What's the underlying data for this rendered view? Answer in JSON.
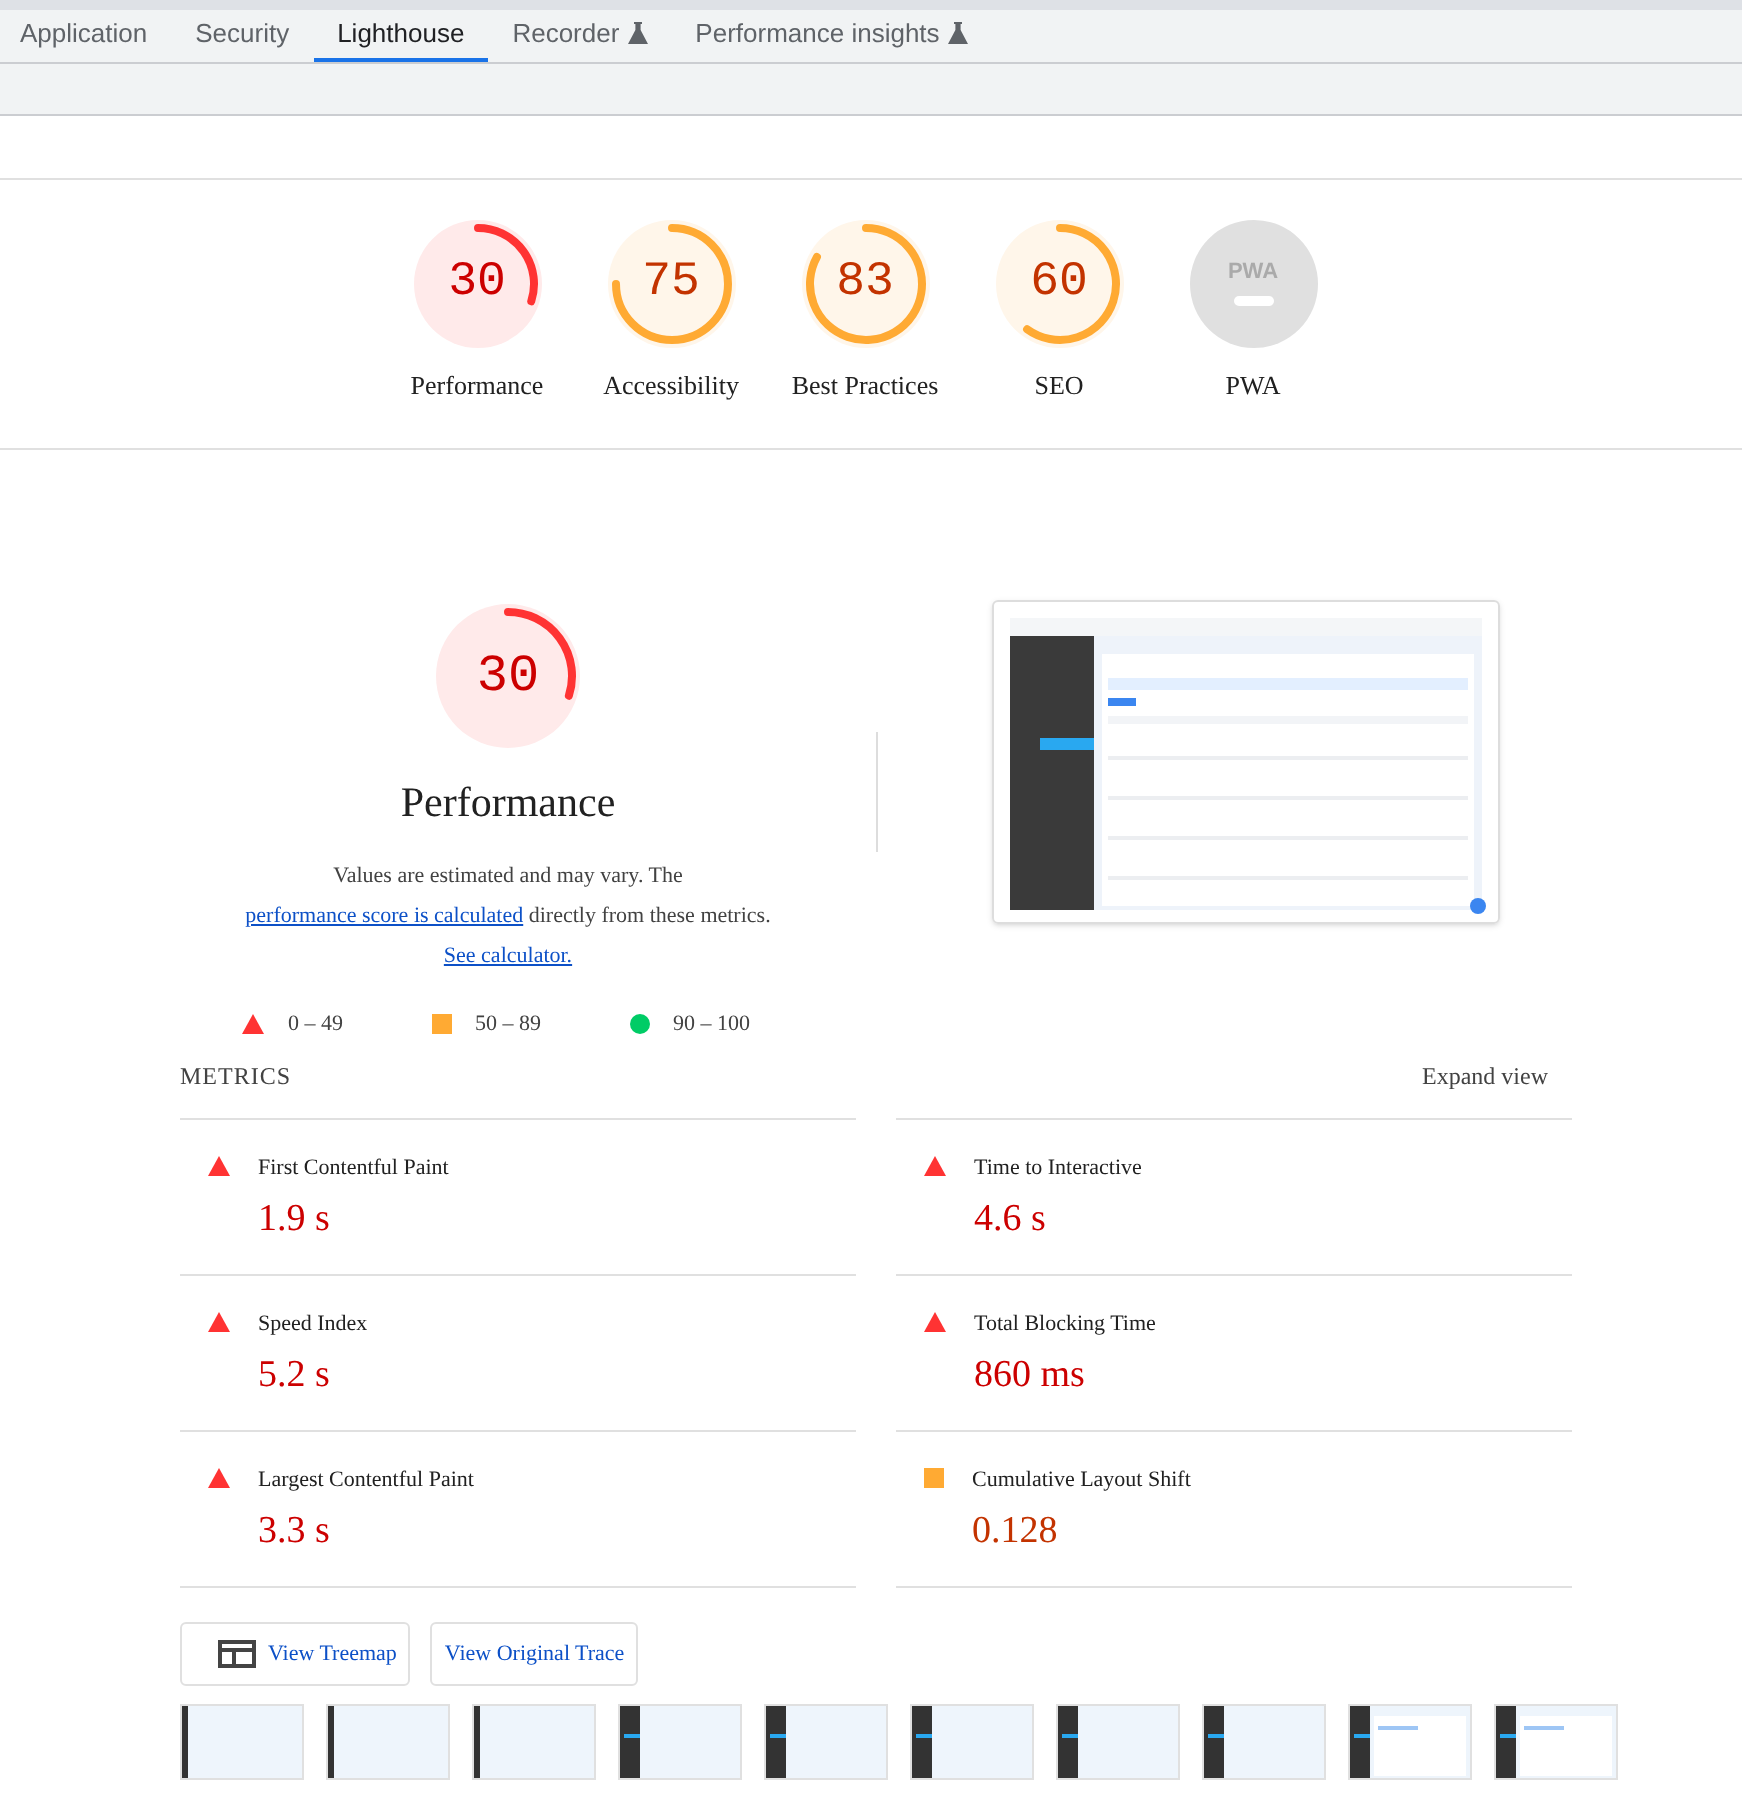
{
  "tabs": [
    {
      "label": "Application",
      "selected": false,
      "experiment": false
    },
    {
      "label": "Security",
      "selected": false,
      "experiment": false
    },
    {
      "label": "Lighthouse",
      "selected": true,
      "experiment": false
    },
    {
      "label": "Recorder",
      "selected": false,
      "experiment": true
    },
    {
      "label": "Performance insights",
      "selected": false,
      "experiment": true
    }
  ],
  "gauges": [
    {
      "kind": "fail",
      "score": "30",
      "label": "Performance"
    },
    {
      "kind": "average",
      "score": "75",
      "label": "Accessibility"
    },
    {
      "kind": "average",
      "score": "83",
      "label": "Best Practices"
    },
    {
      "kind": "average",
      "score": "60",
      "label": "SEO"
    },
    {
      "kind": "pwa",
      "badge": "PWA",
      "label": "PWA"
    }
  ],
  "performance": {
    "score": "30",
    "kind": "fail",
    "title": "Performance",
    "description": [
      {
        "kind": "text",
        "text": "Values are estimated and may vary. The "
      },
      {
        "kind": "link",
        "text": "performance score is calculated"
      },
      {
        "kind": "text",
        "text": " directly from these metrics. "
      },
      {
        "kind": "link",
        "text": "See calculator."
      }
    ],
    "legend": [
      {
        "kind": "fail",
        "range": "0 – 49"
      },
      {
        "kind": "average",
        "range": "50 – 89"
      },
      {
        "kind": "pass",
        "range": "90 – 100"
      }
    ]
  },
  "metrics": {
    "heading": "METRICS",
    "toggle": "Expand view",
    "items": [
      {
        "name": "First Contentful Paint",
        "value": "1.9 s",
        "kind": "fail"
      },
      {
        "name": "Time to Interactive",
        "value": "4.6 s",
        "kind": "fail"
      },
      {
        "name": "Speed Index",
        "value": "5.2 s",
        "kind": "fail"
      },
      {
        "name": "Total Blocking Time",
        "value": "860 ms",
        "kind": "fail"
      },
      {
        "name": "Largest Contentful Paint",
        "value": "3.3 s",
        "kind": "fail"
      },
      {
        "name": "Cumulative Layout Shift",
        "value": "0.128",
        "kind": "average"
      }
    ]
  },
  "buttons": [
    {
      "kind": "treemap",
      "label": "View Treemap"
    },
    {
      "kind": "trace",
      "label": "View Original Trace"
    }
  ],
  "filmstrip": [
    {
      "kind": "blank"
    },
    {
      "kind": "blank"
    },
    {
      "kind": "blank"
    },
    {
      "kind": "sidebar"
    },
    {
      "kind": "sidebar"
    },
    {
      "kind": "sidebar"
    },
    {
      "kind": "sidebar"
    },
    {
      "kind": "sidebar"
    },
    {
      "kind": "page"
    },
    {
      "kind": "page"
    }
  ]
}
